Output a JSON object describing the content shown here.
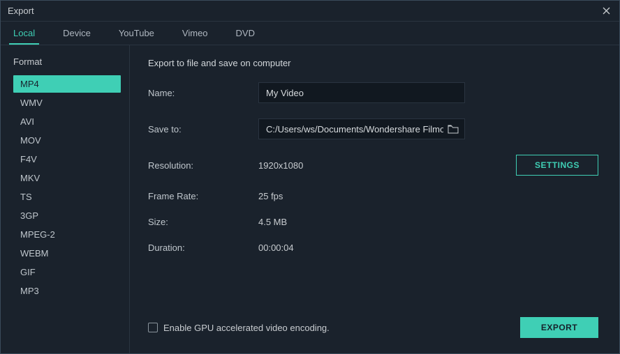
{
  "window": {
    "title": "Export"
  },
  "tabs": [
    {
      "label": "Local",
      "active": true
    },
    {
      "label": "Device",
      "active": false
    },
    {
      "label": "YouTube",
      "active": false
    },
    {
      "label": "Vimeo",
      "active": false
    },
    {
      "label": "DVD",
      "active": false
    }
  ],
  "sidebar": {
    "heading": "Format",
    "formats": [
      {
        "label": "MP4",
        "selected": true
      },
      {
        "label": "WMV",
        "selected": false
      },
      {
        "label": "AVI",
        "selected": false
      },
      {
        "label": "MOV",
        "selected": false
      },
      {
        "label": "F4V",
        "selected": false
      },
      {
        "label": "MKV",
        "selected": false
      },
      {
        "label": "TS",
        "selected": false
      },
      {
        "label": "3GP",
        "selected": false
      },
      {
        "label": "MPEG-2",
        "selected": false
      },
      {
        "label": "WEBM",
        "selected": false
      },
      {
        "label": "GIF",
        "selected": false
      },
      {
        "label": "MP3",
        "selected": false
      }
    ]
  },
  "main": {
    "heading": "Export to file and save on computer",
    "name_label": "Name:",
    "name_value": "My Video",
    "saveto_label": "Save to:",
    "saveto_value": "C:/Users/ws/Documents/Wondershare Filmo",
    "resolution_label": "Resolution:",
    "resolution_value": "1920x1080",
    "settings_button": "SETTINGS",
    "framerate_label": "Frame Rate:",
    "framerate_value": "25 fps",
    "size_label": "Size:",
    "size_value": "4.5 MB",
    "duration_label": "Duration:",
    "duration_value": "00:00:04"
  },
  "footer": {
    "gpu_checkbox_label": "Enable GPU accelerated video encoding.",
    "gpu_checked": false,
    "export_button": "EXPORT"
  }
}
